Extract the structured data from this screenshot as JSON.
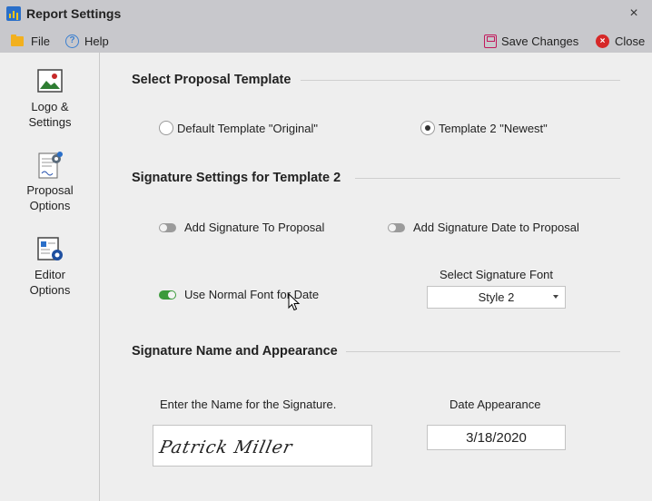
{
  "window": {
    "title": "Report Settings",
    "close_glyph": "×"
  },
  "menu": {
    "file": "File",
    "help": "Help",
    "save": "Save Changes",
    "close": "Close"
  },
  "sidebar": {
    "items": [
      {
        "label_line1": "Logo &",
        "label_line2": "Settings",
        "icon": "image-icon"
      },
      {
        "label_line1": "Proposal",
        "label_line2": "Options",
        "icon": "document-gear-icon"
      },
      {
        "label_line1": "Editor",
        "label_line2": "Options",
        "icon": "editor-gear-icon"
      }
    ]
  },
  "template_section": {
    "title": "Select Proposal Template",
    "options": [
      {
        "label": "Default Template \"Original\"",
        "selected": false
      },
      {
        "label": "Template 2 \"Newest\"",
        "selected": true
      }
    ]
  },
  "signature_settings": {
    "title": "Signature Settings for Template 2",
    "add_signature": {
      "label": "Add Signature To Proposal",
      "on": false
    },
    "add_signature_date": {
      "label": "Add Signature Date to Proposal",
      "on": false
    },
    "normal_font_for_date": {
      "label": "Use Normal Font for Date",
      "on": true
    },
    "font_select_caption": "Select Signature Font",
    "font_select_value": "Style 2"
  },
  "name_appearance": {
    "title": "Signature Name and Appearance",
    "name_caption": "Enter the Name for the Signature.",
    "signature_text": "Patrick Miller",
    "date_caption": "Date Appearance",
    "date_value": "3/18/2020"
  },
  "colors": {
    "titlebar": "#c8c8cc",
    "toggle_on": "#3a9a3a",
    "toggle_off": "#9b9b9b",
    "close_red": "#d62828",
    "save_magenta": "#c2185b"
  }
}
